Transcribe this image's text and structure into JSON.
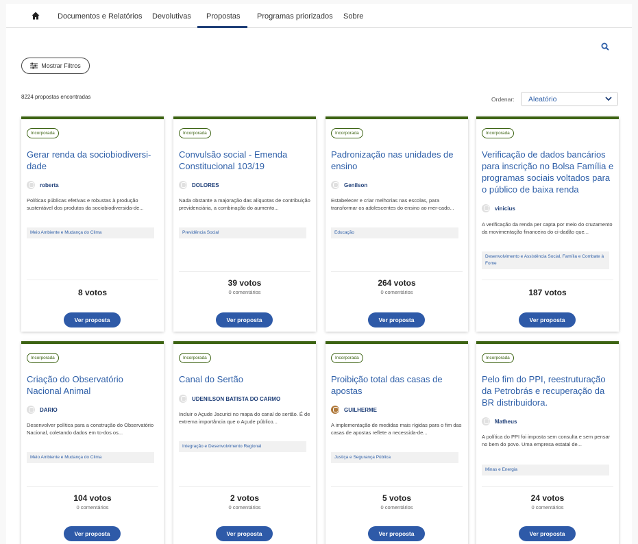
{
  "nav": {
    "home_icon": "home-icon",
    "items": [
      "Documentos e Relatórios",
      "Devolutivas",
      "Propostas",
      "Programas priorizados",
      "Sobre"
    ],
    "active": "Propostas"
  },
  "search_icon": "search-icon",
  "filters": {
    "label": "Mostrar Filtros",
    "icon": "sliders-icon"
  },
  "results_count": "8224 propostas encontradas",
  "order": {
    "label": "Ordenar:",
    "value": "Aleatório"
  },
  "colors": {
    "accent_green": "#3c6312",
    "link_blue": "#2e5fa8",
    "button_blue": "#2e5aa8"
  },
  "cards": [
    {
      "badge": "Incorporada",
      "title": "Gerar renda da sociobiodiversi-dade",
      "author": "roberta",
      "description": "Políticas públicas efetivas e robustas à produção sustentável dos produtos da sociobiodiversida-de...",
      "tag": "Meio Ambiente e Mudança do Clima",
      "votes": "8 votos",
      "comments": "",
      "button": "Ver proposta"
    },
    {
      "badge": "Incorporada",
      "title": "Convulsão social - Emenda Constitucional 103/19",
      "author": "DOLORES",
      "description": "Nada obstante a majoração das alíquotas de contribuição previdenciária, a combinação do aumento...",
      "tag": "Previdência Social",
      "votes": "39 votos",
      "comments": "0 comentários",
      "button": "Ver proposta"
    },
    {
      "badge": "Incorporada",
      "title": "Padronização nas unidades de ensino",
      "author": "Genilson",
      "description": "Estabelecer e criar melhorias nas escolas, para transformar os adolescentes do ensino ao mer-cado...",
      "tag": "Educação",
      "votes": "264 votos",
      "comments": "0 comentários",
      "button": "Ver proposta"
    },
    {
      "badge": "Incorporada",
      "title": "Verificação de dados bancários para inscrição no Bolsa Família e programas sociais voltados para o público de baixa renda",
      "author": "vinicius",
      "description": "A verificação da renda per capta por meio do cruzamento da movimentação financeira do ci-dadão que...",
      "tag": "Desenvolvimento e Assistência Social, Família e Combate à Fome",
      "votes": "187 votos",
      "comments": "",
      "button": "Ver proposta"
    },
    {
      "badge": "Incorporada",
      "title": "Criação do Observatório Nacional Animal",
      "author": "DARIO",
      "description": "Desenvolver política para a construção do Observatório Nacional, coletando dados em to-dos os...",
      "tag": "Meio Ambiente e Mudança do Clima",
      "votes": "104 votos",
      "comments": "0 comentários",
      "button": "Ver proposta"
    },
    {
      "badge": "Incorporada",
      "title": "Canal do Sertão",
      "author": "UDENILSON BATISTA DO CARMO",
      "description": "Incluir o Açude Jacurici no mapa do canal do sertão. É de extrema importância que o Açude público...",
      "tag": "Integração e Desenvolvimento Regional",
      "votes": "2 votos",
      "comments": "0 comentários",
      "button": "Ver proposta"
    },
    {
      "badge": "Incorporada",
      "title": "Proibição total das casas de apostas",
      "author": "GUILHERME",
      "description": "A implementação de medidas mais rígidas para o fim das casas de apostas reflete a necessida-de...",
      "tag": "Justiça e Segurança Pública",
      "votes": "5 votos",
      "comments": "0 comentários",
      "button": "Ver proposta"
    },
    {
      "badge": "Incorporada",
      "title": "Pelo fim do PPI, reestruturação da Petrobrás e recuperação da BR distribuidora.",
      "author": "Matheus",
      "description": "A política do PPI foi imposta sem consulta e sem pensar no bem do povo. Uma empresa estatal de...",
      "tag": "Minas e Energia",
      "votes": "24 votos",
      "comments": "0 comentários",
      "button": "Ver proposta"
    }
  ]
}
